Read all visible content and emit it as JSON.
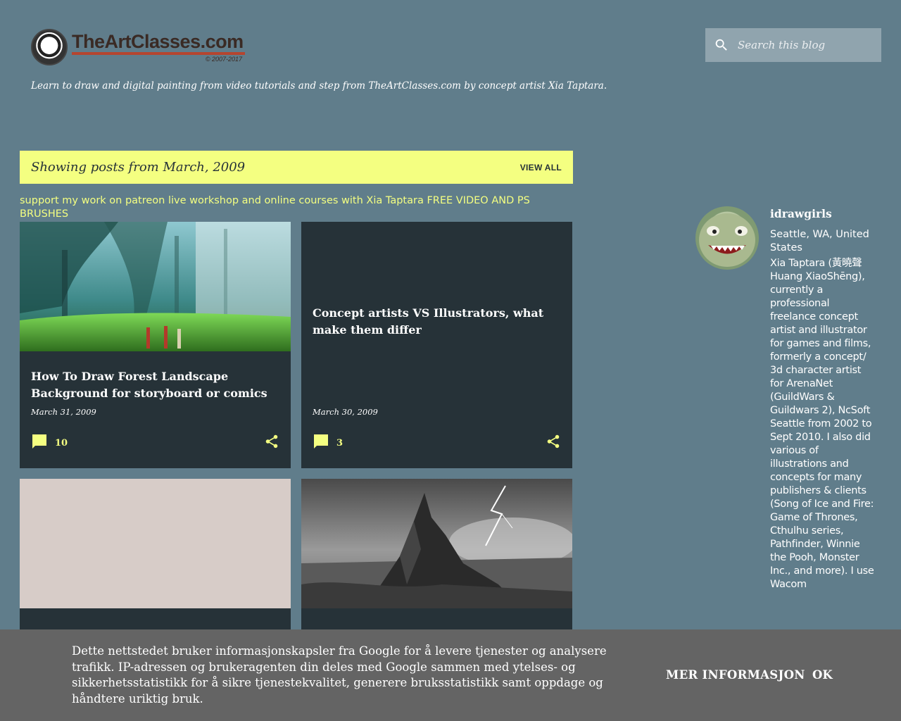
{
  "header": {
    "logo_text": "TheArtClasses.com",
    "logo_copyright": "© 2007-2017",
    "tagline": "Learn to draw and digital painting from video tutorials and step from TheArtClasses.com by concept artist Xia Taptara."
  },
  "search": {
    "placeholder": "Search this blog",
    "icon": "search-icon"
  },
  "filter_bar": {
    "title": "Showing posts from March, 2009",
    "view_all": "VIEW ALL"
  },
  "promo_links": [
    "support my work on patreon",
    "live workshop and online courses with Xia Taptara",
    "FREE VIDEO AND PS BRUSHES"
  ],
  "posts": [
    {
      "title": "How To Draw Forest Landscape Background for storyboard or comics",
      "date": "March 31, 2009",
      "comments": "10"
    },
    {
      "title": "Concept artists VS Illustrators, what make them differ",
      "date": "March 30, 2009",
      "comments": "3"
    }
  ],
  "profile": {
    "name": "idrawgirls",
    "location": "Seattle, WA, United States",
    "bio": "Xia Taptara (黃曉聲 Huang XiaoShēng), currently a professional freelance concept artist and illustrator for games and films, formerly a concept/ 3d character artist for ArenaNet (GuildWars & Guildwars 2), NcSoft Seattle from 2002 to Sept 2010. I also did various of illustrations and concepts for many publishers & clients (Song of Ice and Fire: Game of Thrones, Cthulhu series, Pathfinder, Winnie the Pooh, Monster Inc., and more). I use Wacom"
  },
  "cookie_banner": {
    "text": "Dette nettstedet bruker informasjonskapsler fra Google for å levere tjenester og analysere trafikk. IP-adressen og brukeragenten din deles med Google sammen med ytelses- og sikkerhetsstatistikk for å sikre tjenestekvalitet, generere bruksstatistikk samt oppdage og håndtere uriktig bruk.",
    "more_label": "MER INFORMASJON",
    "ok_label": "OK"
  },
  "colors": {
    "background": "#607d8b",
    "accent": "#f4ff81",
    "card": "#263238",
    "banner": "#646464"
  }
}
